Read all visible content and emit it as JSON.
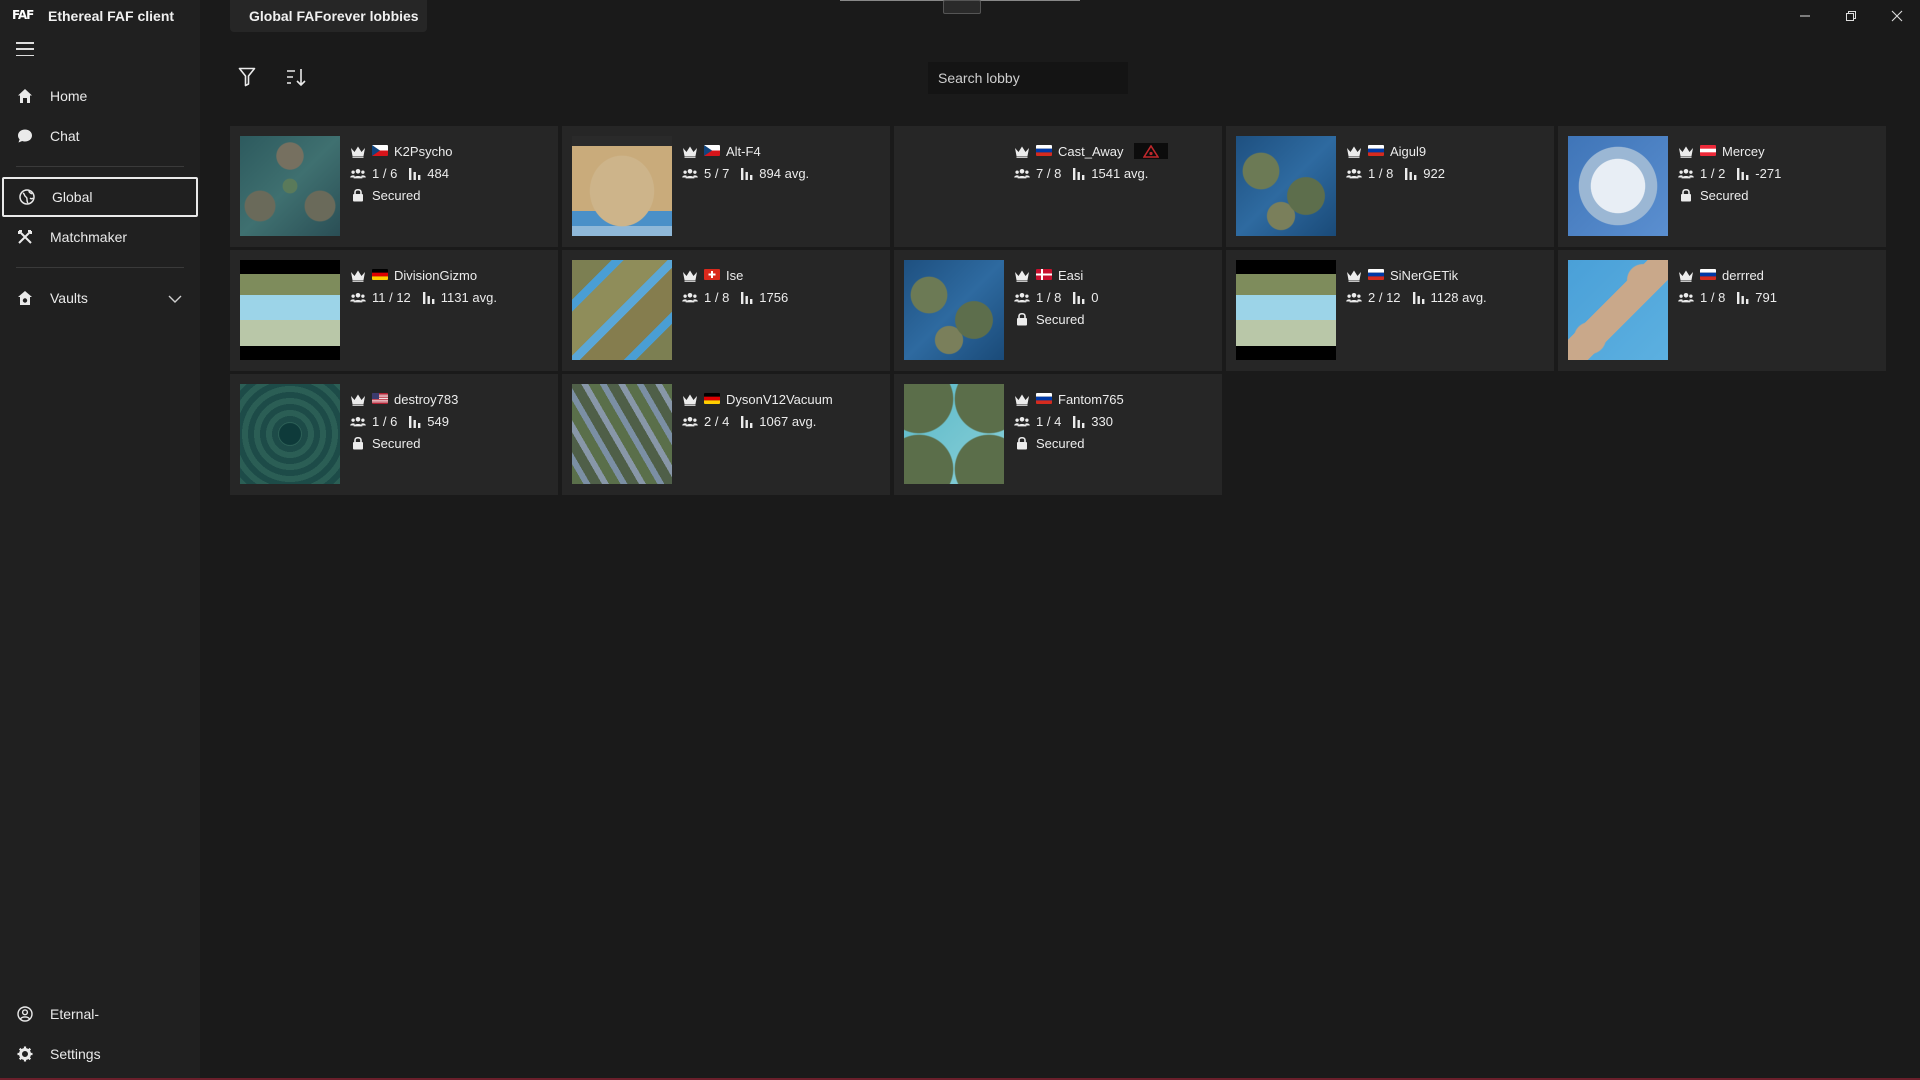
{
  "app": {
    "title": "Ethereal FAF client",
    "logo": "FAF"
  },
  "main": {
    "tab_title": "Global FAForever lobbies"
  },
  "search": {
    "placeholder": "Search lobby"
  },
  "sidebar": {
    "items": [
      {
        "label": "Home",
        "icon": "home-icon"
      },
      {
        "label": "Chat",
        "icon": "chat-icon"
      },
      {
        "label": "Global",
        "icon": "globe-icon",
        "active": true
      },
      {
        "label": "Matchmaker",
        "icon": "swords-icon"
      },
      {
        "label": "Vaults",
        "icon": "vault-icon"
      }
    ],
    "bottom": [
      {
        "label": "Eternal-",
        "icon": "user-icon"
      },
      {
        "label": "Settings",
        "icon": "gear-icon"
      }
    ]
  },
  "lobbies": [
    {
      "host": "K2Psycho",
      "flag": "cz",
      "players": "1 / 6",
      "rating": "484",
      "secured": "Secured",
      "map": "m1"
    },
    {
      "host": "Alt-F4",
      "flag": "cz",
      "players": "5 / 7",
      "rating": "894 avg.",
      "secured": "",
      "map": "m2"
    },
    {
      "host": "Cast_Away",
      "flag": "ru",
      "players": "7 / 8",
      "rating": "1541 avg.",
      "secured": "",
      "map": "none",
      "badge": true
    },
    {
      "host": "Aigul9",
      "flag": "ru",
      "players": "1 / 8",
      "rating": "922",
      "secured": "",
      "map": "m4"
    },
    {
      "host": "Mercey",
      "flag": "at",
      "players": "1 / 2",
      "rating": "-271",
      "secured": "Secured",
      "map": "m5"
    },
    {
      "host": "DivisionGizmo",
      "flag": "de",
      "players": "11 / 12",
      "rating": "1131 avg.",
      "secured": "",
      "map": "m6"
    },
    {
      "host": "Ise",
      "flag": "ch",
      "players": "1 / 8",
      "rating": "1756",
      "secured": "",
      "map": "m7"
    },
    {
      "host": "Easi",
      "flag": "dk",
      "players": "1 / 8",
      "rating": "0",
      "secured": "Secured",
      "map": "m4"
    },
    {
      "host": "SiNerGETik",
      "flag": "ru",
      "players": "2 / 12",
      "rating": "1128 avg.",
      "secured": "",
      "map": "m6"
    },
    {
      "host": "derrred",
      "flag": "ru",
      "players": "1 / 8",
      "rating": "791",
      "secured": "",
      "map": "m10"
    },
    {
      "host": "destroy783",
      "flag": "us",
      "players": "1 / 6",
      "rating": "549",
      "secured": "Secured",
      "map": "m11"
    },
    {
      "host": "DysonV12Vacuum",
      "flag": "de",
      "players": "2 / 4",
      "rating": "1067 avg.",
      "secured": "",
      "map": "m12"
    },
    {
      "host": "Fantom765",
      "flag": "ru",
      "players": "1 / 4",
      "rating": "330",
      "secured": "Secured",
      "map": "m13"
    }
  ],
  "colors": {
    "background": "#1a1a1a",
    "sidebar": "#202020",
    "card": "#262626",
    "accent_line": "#6b1f2b"
  }
}
